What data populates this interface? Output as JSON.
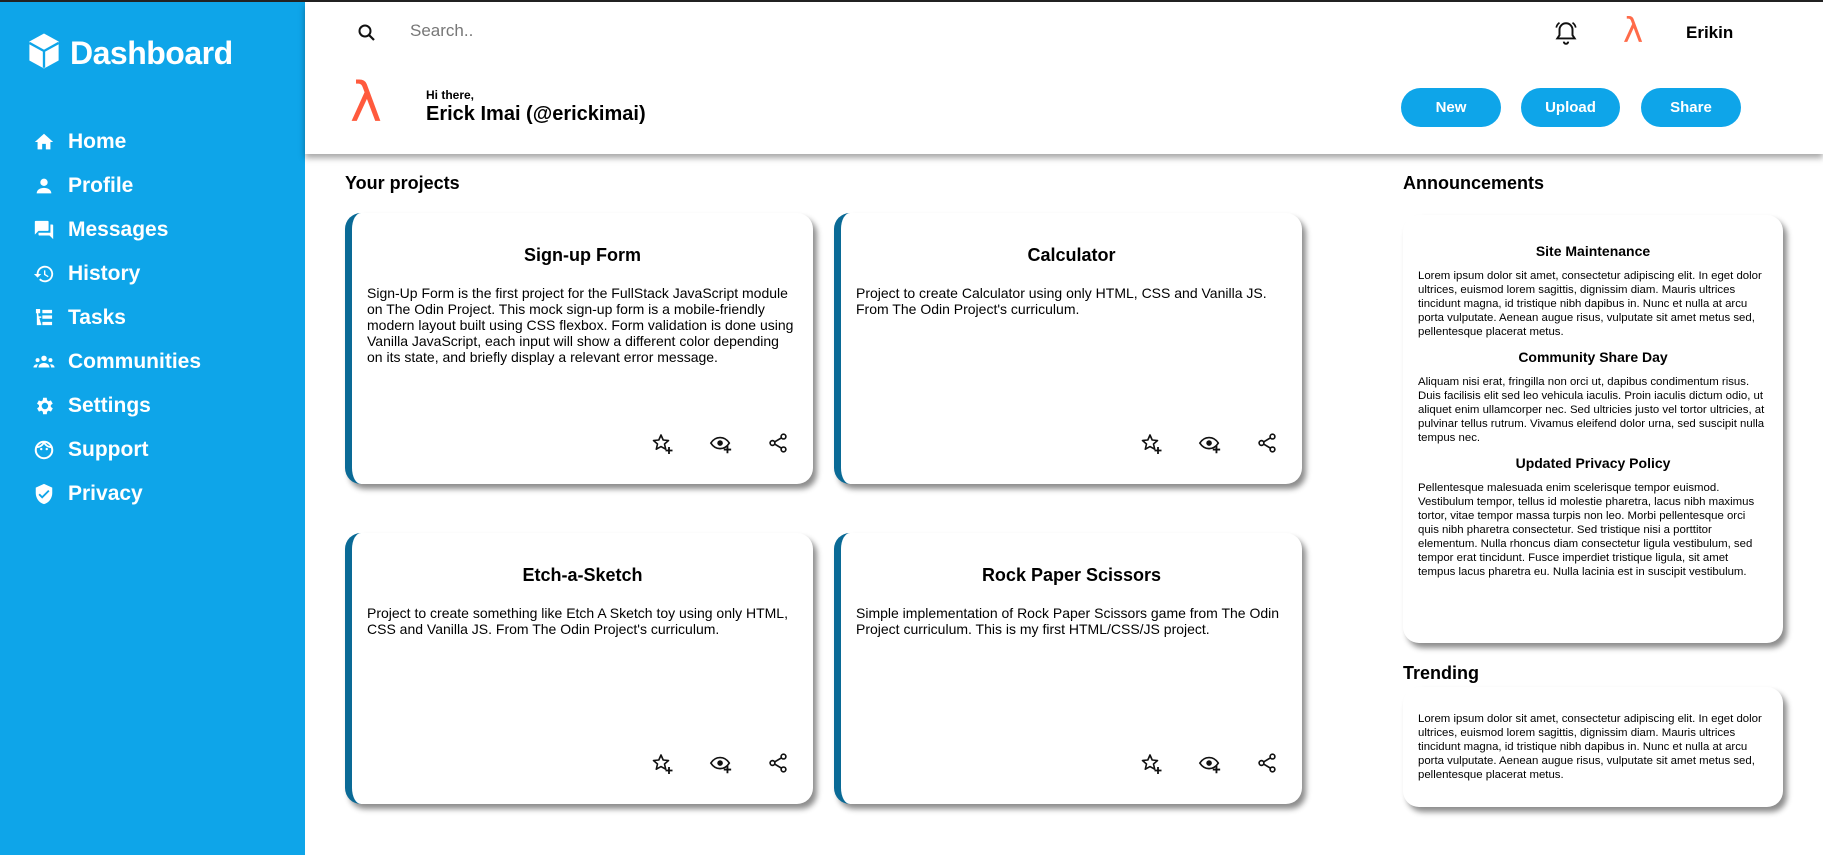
{
  "sidebar": {
    "brand": "Dashboard",
    "items": [
      {
        "label": "Home",
        "icon": "home-icon"
      },
      {
        "label": "Profile",
        "icon": "person-icon"
      },
      {
        "label": "Messages",
        "icon": "messages-icon"
      },
      {
        "label": "History",
        "icon": "history-icon"
      },
      {
        "label": "Tasks",
        "icon": "tasks-icon"
      },
      {
        "label": "Communities",
        "icon": "communities-icon"
      },
      {
        "label": "Settings",
        "icon": "gear-icon"
      },
      {
        "label": "Support",
        "icon": "support-icon"
      },
      {
        "label": "Privacy",
        "icon": "shield-icon"
      }
    ]
  },
  "header": {
    "search_placeholder": "Search..",
    "user_short": "Erikin",
    "avatar_glyph": "λ",
    "greeting": "Hi there,",
    "user_full": "Erick Imai (@erickimai)",
    "buttons": {
      "new": "New",
      "upload": "Upload",
      "share": "Share"
    }
  },
  "main": {
    "projects_title": "Your projects",
    "projects": [
      {
        "title": "Sign-up Form",
        "description": "Sign-Up Form is the first project for the FullStack JavaScript module on The Odin Project. This mock sign-up form is a mobile-friendly modern layout built using CSS flexbox. Form validation is done using Vanilla JavaScript, each input will show a different color depending on its state, and briefly display a relevant error message."
      },
      {
        "title": "Calculator",
        "description": "Project to create Calculator using only HTML, CSS and Vanilla JS. From The Odin Project's curriculum."
      },
      {
        "title": "Etch-a-Sketch",
        "description": "Project to create something like Etch A Sketch toy using only HTML, CSS and Vanilla JS. From The Odin Project's curriculum."
      },
      {
        "title": "Rock Paper Scissors",
        "description": "Simple implementation of Rock Paper Scissors game from The Odin Project curriculum. This is my first HTML/CSS/JS project."
      }
    ],
    "announcements_title": "Announcements",
    "announcements": [
      {
        "title": "Site Maintenance",
        "body": "Lorem ipsum dolor sit amet, consectetur adipiscing elit. In eget dolor ultrices, euismod lorem sagittis, dignissim diam. Mauris ultrices tincidunt magna, id tristique nibh dapibus in. Nunc et nulla at arcu porta vulputate. Aenean augue risus, vulputate sit amet metus sed, pellentesque placerat metus."
      },
      {
        "title": "Community Share Day",
        "body": "Aliquam nisi erat, fringilla non orci ut, dapibus condimentum risus. Duis facilisis elit sed leo vehicula iaculis. Proin iaculis dictum odio, ut aliquet enim ullamcorper nec. Sed ultricies justo vel tortor ultricies, at pulvinar tellus rutrum. Vivamus eleifend dolor urna, sed suscipit nulla tempus nec."
      },
      {
        "title": "Updated Privacy Policy",
        "body": "Pellentesque malesuada enim scelerisque tempor euismod. Vestibulum tempor, tellus id molestie pharetra, lacus nibh maximus tortor, vitae tempor massa turpis non leo. Morbi pellentesque orci quis nibh pharetra consectetur. Sed tristique nisi a porttitor elementum. Nulla rhoncus diam consectetur ligula vestibulum, sed tempor erat tincidunt. Fusce imperdiet tristique ligula, sit amet tempus lacus pharetra eu. Nulla lacinia est in suscipit vestibulum."
      }
    ],
    "trending_title": "Trending",
    "trending_body": "Lorem ipsum dolor sit amet, consectetur adipiscing elit. In eget dolor ultrices, euismod lorem sagittis, dignissim diam. Mauris ultrices tincidunt magna, id tristique nibh dapibus in. Nunc et nulla at arcu porta vulputate. Aenean augue risus, vulputate sit amet metus sed, pellentesque placerat metus."
  },
  "colors": {
    "sidebar": "#0ea5e9",
    "button": "#0ea5e9",
    "card_accent": "#0a6a96",
    "avatar": "#ff6b4a"
  }
}
